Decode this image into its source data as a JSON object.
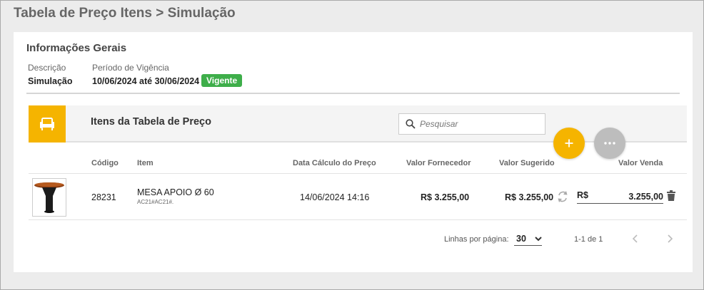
{
  "page": {
    "title": "Tabela de Preço Itens > Simulação"
  },
  "general": {
    "section_title": "Informações Gerais",
    "description_label": "Descrição",
    "description_value": "Simulação",
    "period_label": "Período de Vigência",
    "period_value": "10/06/2024 até 30/06/2024",
    "status_badge": "Vigente"
  },
  "items": {
    "title": "Itens da Tabela de Preço",
    "search_placeholder": "Pesquisar",
    "add_label": "+",
    "columns": {
      "code": "Código",
      "item": "Item",
      "calc_date": "Data Cálculo do Preço",
      "supplier_value": "Valor Fornecedor",
      "suggested_value": "Valor Sugerido",
      "sale_value": "Valor Venda"
    },
    "rows": [
      {
        "code": "28231",
        "item_name": "MESA APOIO Ø 60",
        "item_ref": "AC21#AC21#.",
        "calc_date": "14/06/2024 14:16",
        "supplier_value": "R$ 3.255,00",
        "suggested_value": "R$ 3.255,00",
        "sale_currency": "R$",
        "sale_value": "3.255,00"
      }
    ]
  },
  "pagination": {
    "rows_per_page_label": "Linhas por página:",
    "rows_per_page_value": "30",
    "range_text": "1-1 de 1"
  },
  "colors": {
    "accent": "#f5b400",
    "badge_green": "#3eae4a",
    "fab_grey": "#bdbdbd"
  },
  "icons": [
    "armchair-icon",
    "search-icon",
    "plus-icon",
    "more-icon",
    "refresh-icon",
    "trash-icon",
    "chevron-down-icon",
    "chevron-left-icon",
    "chevron-right-icon"
  ]
}
